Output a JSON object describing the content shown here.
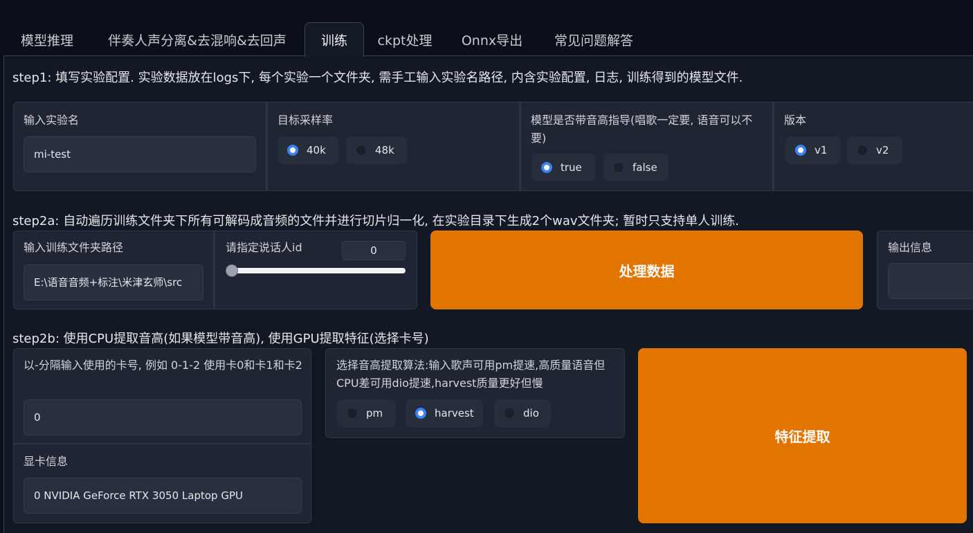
{
  "tabs": [
    {
      "label": "模型推理",
      "active": false
    },
    {
      "label": "伴奏人声分离&去混响&去回声",
      "active": false
    },
    {
      "label": "训练",
      "active": true
    },
    {
      "label": "ckpt处理",
      "active": false
    },
    {
      "label": "Onnx导出",
      "active": false
    },
    {
      "label": "常见问题解答",
      "active": false
    }
  ],
  "step1": {
    "text": "step1: 填写实验配置. 实验数据放在logs下, 每个实验一个文件夹, 需手工输入实验名路径, 内含实验配置, 日志, 训练得到的模型文件.",
    "exp_name": {
      "label": "输入实验名",
      "value": "mi-test"
    },
    "sample_rate": {
      "label": "目标采样率",
      "options": [
        "40k",
        "48k"
      ],
      "selected": "40k"
    },
    "pitch_guidance": {
      "label": "模型是否带音高指导(唱歌一定要, 语音可以不要)",
      "options": [
        "true",
        "false"
      ],
      "selected": "true"
    },
    "version": {
      "label": "版本",
      "options": [
        "v1",
        "v2"
      ],
      "selected": "v1"
    }
  },
  "step2a": {
    "text": "step2a: 自动遍历训练文件夹下所有可解码成音频的文件并进行切片归一化, 在实验目录下生成2个wav文件夹; 暂时只支持单人训练.",
    "folder": {
      "label": "输入训练文件夹路径",
      "value": "E:\\语音音频+标注\\米津玄师\\src"
    },
    "speaker_id": {
      "label": "请指定说话人id",
      "value": "0",
      "fraction": 0.0
    },
    "process_button": "处理数据",
    "output": {
      "label": "输出信息",
      "value": ""
    }
  },
  "step2b": {
    "text": "step2b: 使用CPU提取音高(如果模型带音高), 使用GPU提取特征(选择卡号)",
    "gpus": {
      "label": "以-分隔输入使用的卡号, 例如 0-1-2 使用卡0和卡1和卡2",
      "value": "0"
    },
    "gpu_info": {
      "label": "显卡信息",
      "value": "0 NVIDIA GeForce RTX 3050 Laptop GPU"
    },
    "f0_method": {
      "label": "选择音高提取算法:输入歌声可用pm提速,高质量语音但CPU差可用dio提速,harvest质量更好但慢",
      "options": [
        "pm",
        "harvest",
        "dio"
      ],
      "selected": "harvest"
    },
    "extract_button": "特征提取"
  },
  "colors": {
    "accent": "#e27400",
    "radio_on": "#3b82f6",
    "background": "#0b0f19"
  }
}
